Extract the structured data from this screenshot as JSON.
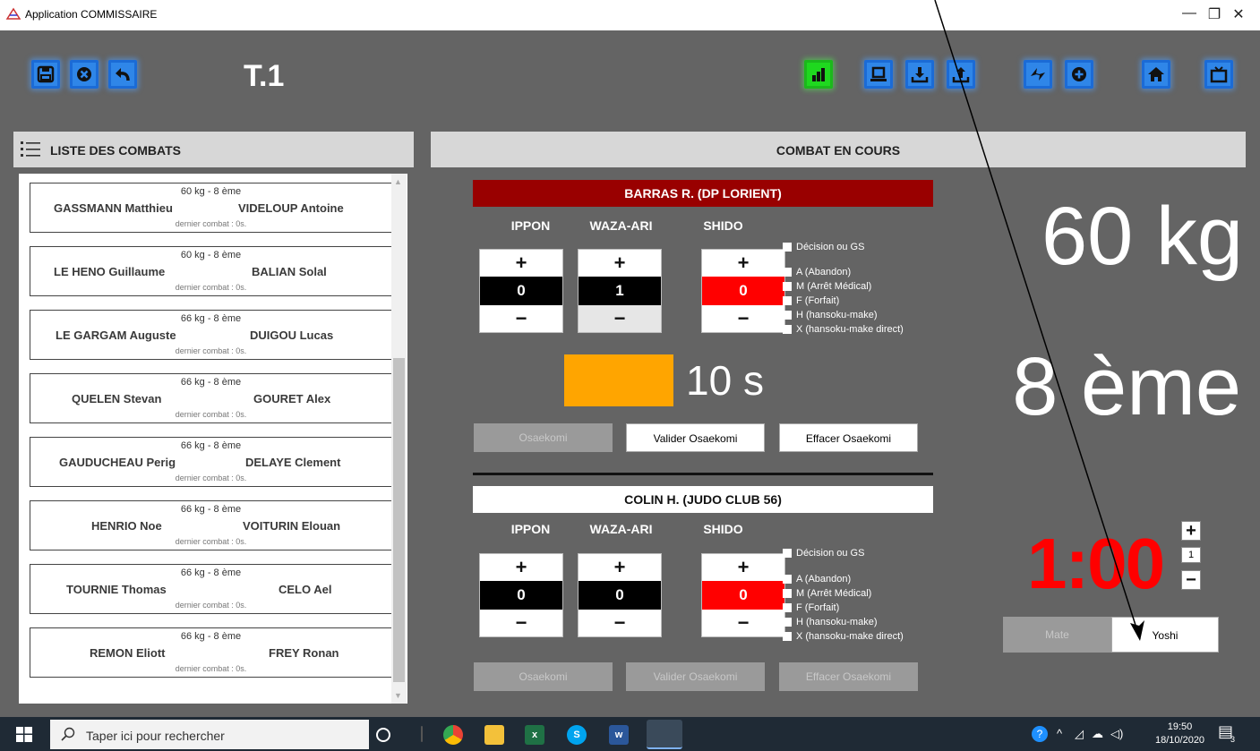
{
  "window": {
    "title": "Application COMMISSAIRE",
    "controls": [
      "—",
      "❐",
      "✕"
    ]
  },
  "header": {
    "tatami": "T.1"
  },
  "left_panel": {
    "title": "LISTE DES COMBATS",
    "fights": [
      {
        "category": "60 kg - 8 ème",
        "fighter1": "GASSMANN Matthieu",
        "fighter2": "VIDELOUP Antoine",
        "last": "dernier combat : 0s."
      },
      {
        "category": "60 kg - 8 ème",
        "fighter1": "LE HENO Guillaume",
        "fighter2": "BALIAN Solal",
        "last": "dernier combat : 0s."
      },
      {
        "category": "66 kg - 8 ème",
        "fighter1": "LE GARGAM Auguste",
        "fighter2": "DUIGOU Lucas",
        "last": "dernier combat : 0s."
      },
      {
        "category": "66 kg - 8 ème",
        "fighter1": "QUELEN Stevan",
        "fighter2": "GOURET Alex",
        "last": "dernier combat : 0s."
      },
      {
        "category": "66 kg - 8 ème",
        "fighter1": "GAUDUCHEAU Perig",
        "fighter2": "DELAYE Clement",
        "last": "dernier combat : 0s."
      },
      {
        "category": "66 kg - 8 ème",
        "fighter1": "HENRIO Noe",
        "fighter2": "VOITURIN Elouan",
        "last": "dernier combat : 0s."
      },
      {
        "category": "66 kg - 8 ème",
        "fighter1": "TOURNIE Thomas",
        "fighter2": "CELO Ael",
        "last": "dernier combat : 0s."
      },
      {
        "category": "66 kg - 8 ème",
        "fighter1": "REMON Eliott",
        "fighter2": "FREY Ronan",
        "last": "dernier combat : 0s."
      }
    ]
  },
  "right_panel": {
    "title": "COMBAT EN COURS",
    "labels": {
      "ippon": "IPPON",
      "waza_ari": "WAZA-ARI",
      "shido": "SHIDO",
      "plus": "+",
      "minus": "−"
    },
    "penalties": [
      "Décision ou GS",
      "A (Abandon)",
      "M (Arrêt Médical)",
      "F (Forfait)",
      "H (hansoku-make)",
      "X (hansoku-make direct)"
    ],
    "red": {
      "name": "BARRAS R.  (DP LORIENT)",
      "ippon": "0",
      "waza_ari": "1",
      "shido": "0",
      "banner_color": "#990000"
    },
    "white": {
      "name": "COLIN H.  (JUDO CLUB 56)",
      "ippon": "0",
      "waza_ari": "0",
      "shido": "0"
    },
    "osaekomi": {
      "time": "10 s",
      "start": "Osaekomi",
      "validate": "Valider Osaekomi",
      "clear": "Effacer Osaekomi"
    },
    "category": {
      "weight": "60 kg",
      "rank": "8 ème"
    },
    "clock": {
      "time": "1:00",
      "step": "1",
      "plus": "+",
      "minus": "−"
    },
    "mate": "Mate",
    "yoshi": "Yoshi"
  },
  "taskbar": {
    "search_placeholder": "Taper ici pour rechercher",
    "time": "19:50",
    "date": "18/10/2020",
    "notifications": "3"
  }
}
